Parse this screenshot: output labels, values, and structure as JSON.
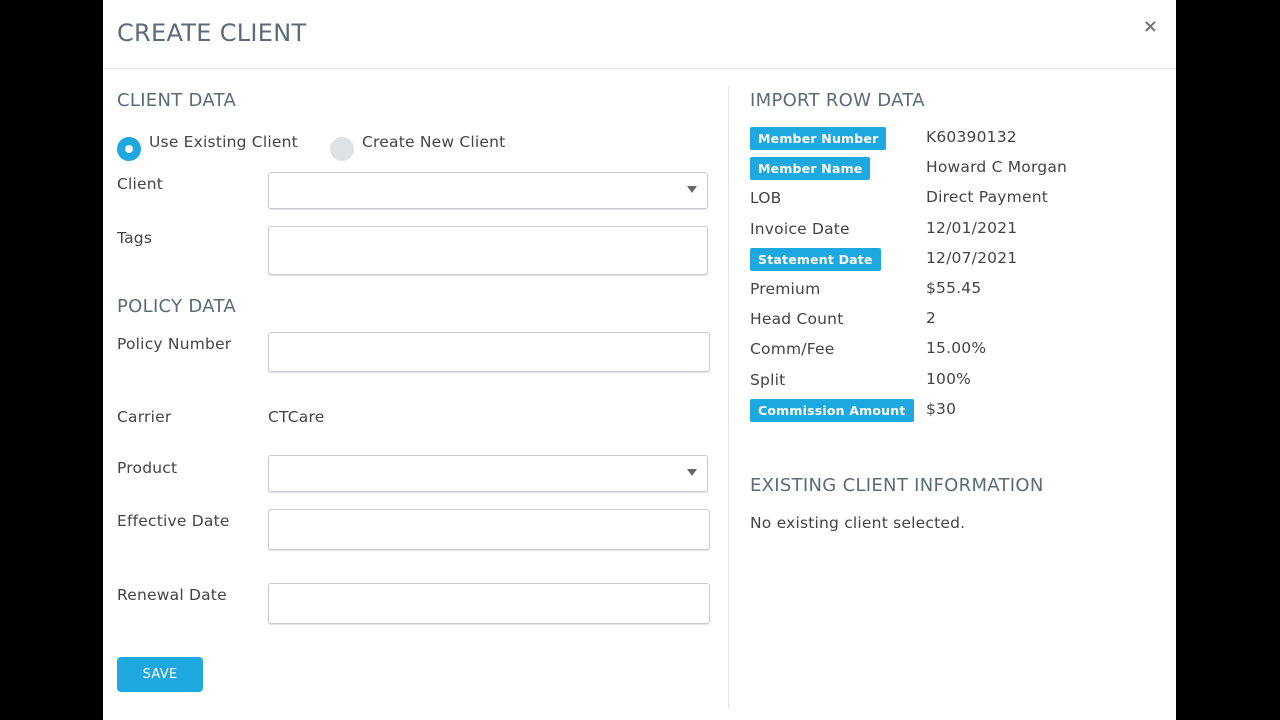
{
  "modal": {
    "title": "CREATE CLIENT",
    "close_icon": "×"
  },
  "client_section": {
    "title": "CLIENT DATA",
    "radio_existing": "Use Existing Client",
    "radio_new": "Create New Client",
    "client_label": "Client",
    "client_value": "",
    "tags_label": "Tags",
    "tags_value": ""
  },
  "policy_section": {
    "title": "POLICY DATA",
    "policy_number_label": "Policy Number",
    "policy_number_value": "",
    "carrier_label": "Carrier",
    "carrier_value": "CTCare",
    "product_label": "Product",
    "product_value": "",
    "effective_date_label": "Effective Date",
    "effective_date_value": "",
    "renewal_date_label": "Renewal Date",
    "renewal_date_value": ""
  },
  "save_label": "SAVE",
  "import_section": {
    "title": "IMPORT ROW DATA",
    "rows": [
      {
        "label": "Member Number",
        "value": "K60390132",
        "highlighted": true
      },
      {
        "label": "Member Name",
        "value": "Howard C Morgan",
        "highlighted": true
      },
      {
        "label": "LOB",
        "value": "Direct Payment",
        "highlighted": false
      },
      {
        "label": "Invoice Date",
        "value": "12/01/2021",
        "highlighted": false
      },
      {
        "label": "Statement Date",
        "value": "12/07/2021",
        "highlighted": true
      },
      {
        "label": "Premium",
        "value": "$55.45",
        "highlighted": false
      },
      {
        "label": "Head Count",
        "value": "2",
        "highlighted": false
      },
      {
        "label": "Comm/Fee",
        "value": "15.00%",
        "highlighted": false
      },
      {
        "label": "Split",
        "value": "100%",
        "highlighted": false
      },
      {
        "label": "Commission Amount",
        "value": "$30",
        "highlighted": true
      }
    ]
  },
  "existing_client_section": {
    "title": "EXISTING CLIENT INFORMATION",
    "message": "No existing client selected."
  },
  "colors": {
    "accent": "#1ea8e0",
    "heading": "#5b6b78"
  }
}
